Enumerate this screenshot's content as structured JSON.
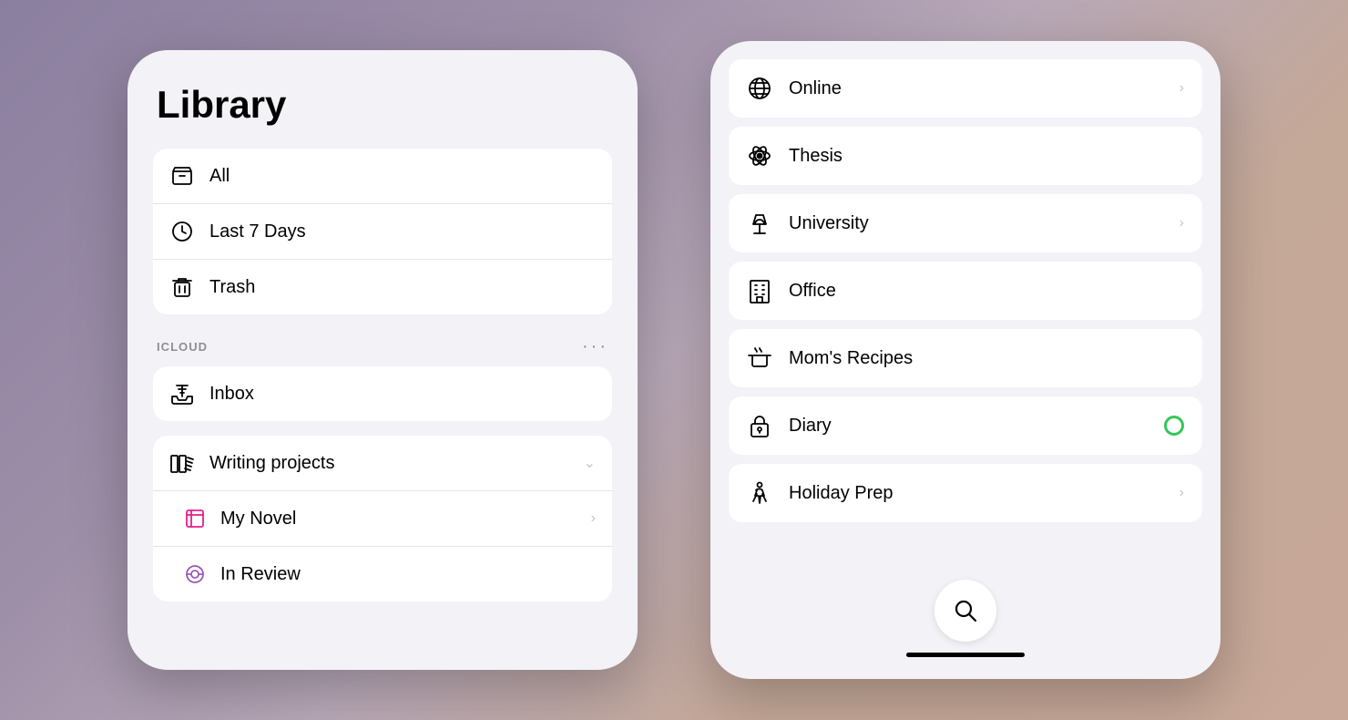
{
  "left_phone": {
    "title": "Library",
    "system_items": [
      {
        "id": "all",
        "label": "All",
        "icon": "archive-icon"
      },
      {
        "id": "last7days",
        "label": "Last 7 Days",
        "icon": "clock-icon"
      },
      {
        "id": "trash",
        "label": "Trash",
        "icon": "trash-icon"
      }
    ],
    "section_label": "ICLOUD",
    "section_dots": "···",
    "icloud_items": [
      {
        "id": "inbox",
        "label": "Inbox",
        "icon": "inbox-icon"
      }
    ],
    "writing_projects": {
      "label": "Writing projects",
      "icon": "books-icon",
      "expanded": true,
      "children": [
        {
          "id": "mynovel",
          "label": "My Novel",
          "icon": "novel-icon",
          "color": "pink",
          "has_chevron": true
        },
        {
          "id": "inreview",
          "label": "In Review",
          "icon": "review-icon",
          "color": "purple",
          "has_chevron": false
        }
      ]
    }
  },
  "right_phone": {
    "items": [
      {
        "id": "online",
        "label": "Online",
        "icon": "globe-icon",
        "has_chevron": true,
        "has_dot": false
      },
      {
        "id": "thesis",
        "label": "Thesis",
        "icon": "atom-icon",
        "has_chevron": false,
        "has_dot": false
      },
      {
        "id": "university",
        "label": "University",
        "icon": "lamp-icon",
        "has_chevron": true,
        "has_dot": false
      },
      {
        "id": "office",
        "label": "Office",
        "icon": "building-icon",
        "has_chevron": false,
        "has_dot": false
      },
      {
        "id": "momsrecipes",
        "label": "Mom's Recipes",
        "icon": "pot-icon",
        "has_chevron": false,
        "has_dot": false
      },
      {
        "id": "diary",
        "label": "Diary",
        "icon": "lock-icon",
        "has_chevron": false,
        "has_dot": true
      },
      {
        "id": "holidayprep",
        "label": "Holiday Prep",
        "icon": "hike-icon",
        "has_chevron": true,
        "has_dot": false
      }
    ],
    "search_label": "search"
  }
}
